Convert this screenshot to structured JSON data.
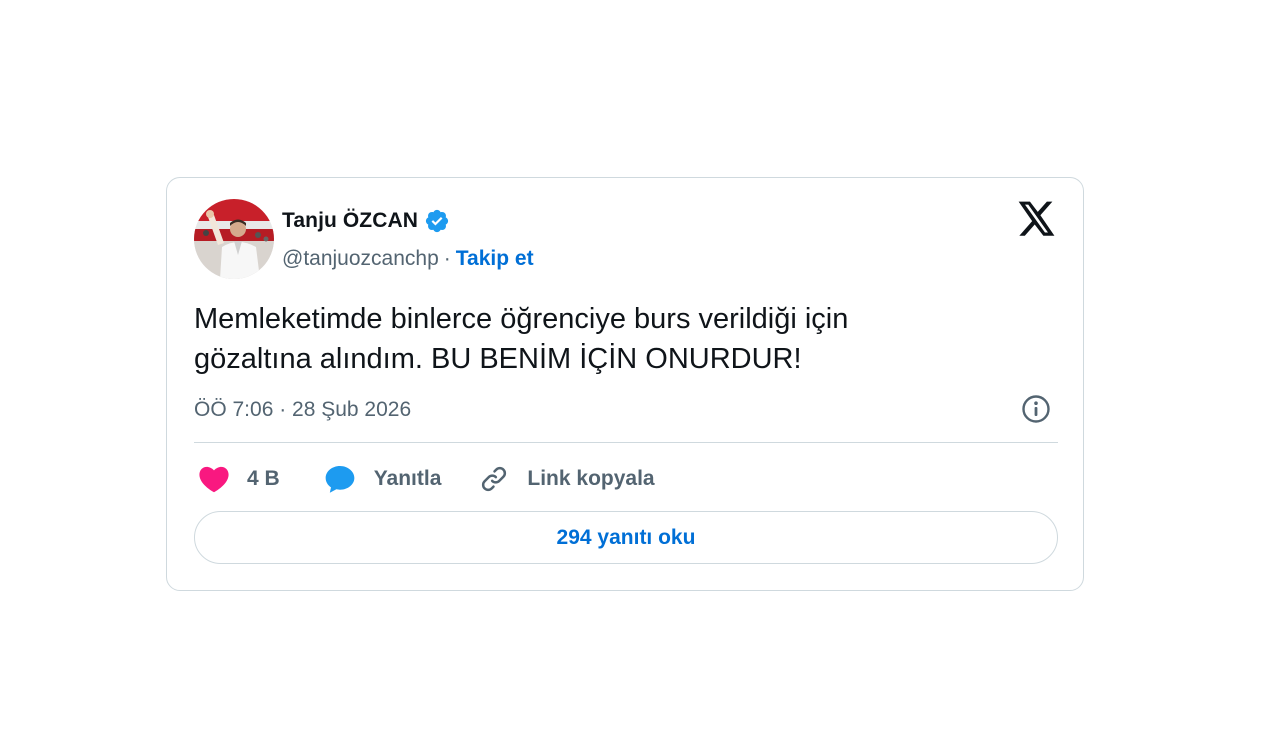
{
  "tweet": {
    "author": {
      "display_name": "Tanju ÖZCAN",
      "handle": "@tanjuozcanchp",
      "verified": true,
      "separator": "·",
      "follow_label": "Takip et"
    },
    "text_lines": [
      "Memleketimde binlerce öğrenciye burs verildiği için",
      "gözaltına alındım. BU BENİM İÇİN ONURDUR!"
    ],
    "timestamp": "ÖÖ 7:06 · 28 Şub 2026",
    "actions": {
      "like_count": "4 B",
      "reply_label": "Yanıtla",
      "copy_link_label": "Link kopyala"
    },
    "read_replies_label": "294 yanıtı oku"
  },
  "icons": {
    "brand": "x-logo-icon",
    "verified": "verified-badge-icon",
    "info": "info-icon",
    "like": "heart-icon",
    "reply": "speech-bubble-icon",
    "link": "link-icon"
  },
  "colors": {
    "accent_blue": "#006fd6",
    "verified_blue": "#1d9bf0",
    "heart_pink": "#f91880",
    "text_primary": "#0f1419",
    "text_secondary": "#536471",
    "border": "#cfd9de"
  }
}
